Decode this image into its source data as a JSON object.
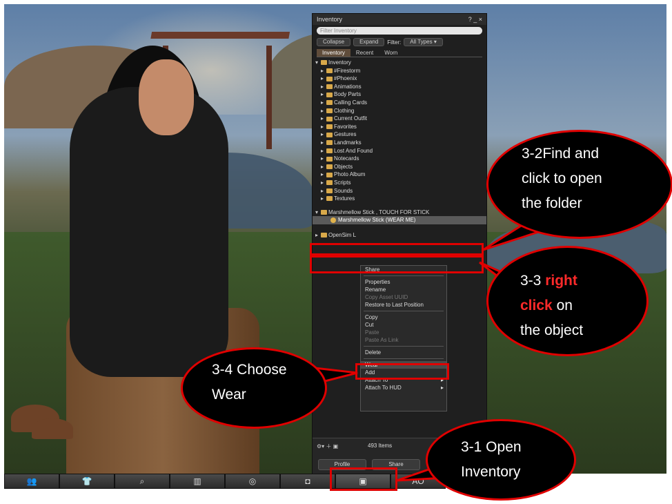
{
  "inventory": {
    "title": "Inventory",
    "title_controls": "? _ ×",
    "filter_placeholder": "Filter Inventory",
    "collapse": "Collapse",
    "expand": "Expand",
    "filter_label": "Filter:",
    "filter_value": "All Types",
    "tabs": [
      "Inventory",
      "Recent",
      "Worn"
    ],
    "root": "Inventory",
    "folders": [
      "#Firestorm",
      "#Phoenix",
      "Animations",
      "Body Parts",
      "Calling Cards",
      "Clothing",
      "Current Outfit",
      "Favorites",
      "Gestures",
      "Landmarks",
      "Lost And Found",
      "Notecards",
      "Objects",
      "Photo Album",
      "Scripts",
      "Sounds",
      "Textures"
    ],
    "open_folder": "Marshmellow Stick , TOUCH FOR STICK",
    "selected_item": "Marshmellow Stick (WEAR ME)",
    "other_folder": "OpenSim L",
    "item_count": "493 Items",
    "bottom_buttons": [
      "Profile",
      "Share"
    ]
  },
  "context_menu": {
    "items": [
      "Share",
      "Properties",
      "Rename",
      "Copy Asset UUID",
      "Restore to Last Position",
      "Copy",
      "Cut",
      "Paste",
      "Paste As Link",
      "Delete",
      "Wear",
      "Add",
      "Attach To",
      "Attach To HUD"
    ]
  },
  "toolbar": {
    "ao_label": "AO"
  },
  "annotations": {
    "step_3_2": [
      "3-2Find and",
      "click to open",
      "the folder"
    ],
    "step_3_3_prefix": "3-3",
    "step_3_3_bold": "right",
    "step_3_3_bold2": "click",
    "step_3_3_rest": "on",
    "step_3_3_line3": "the object",
    "step_3_4": [
      "3-4 Choose",
      "Wear"
    ],
    "step_3_1": [
      "3-1 Open",
      "Inventory"
    ]
  },
  "colors": {
    "annotation_red": "#e00000",
    "bubble_fill": "#000000"
  }
}
